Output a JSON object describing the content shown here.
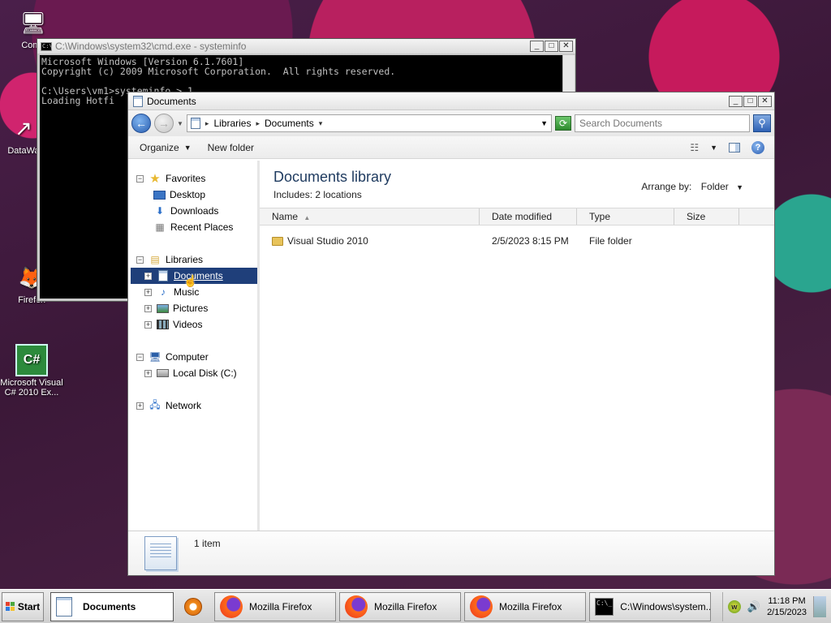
{
  "desktop": {
    "icons": [
      {
        "label": "Comp",
        "glyph": "🖥"
      },
      {
        "label": "DataWa",
        "glyph": "↗"
      },
      {
        "label": "Firefox",
        "glyph": "🦊"
      },
      {
        "label": "Microsoft Visual C# 2010 Ex...",
        "glyph": "C#"
      }
    ]
  },
  "cmd": {
    "title": "C:\\Windows\\system32\\cmd.exe - systeminfo",
    "lines": "Microsoft Windows [Version 6.1.7601]\nCopyright (c) 2009 Microsoft Corporation.  All rights reserved.\n\nC:\\Users\\vm1>systeminfo > 1\nLoading Hotfi"
  },
  "explorer": {
    "title": "Documents",
    "breadcrumb": [
      "Libraries",
      "Documents"
    ],
    "search_placeholder": "Search Documents",
    "toolbar": {
      "organize": "Organize",
      "new_folder": "New folder"
    },
    "nav": {
      "favorites": "Favorites",
      "desktop": "Desktop",
      "downloads": "Downloads",
      "recent": "Recent Places",
      "libraries": "Libraries",
      "documents": "Documents",
      "music": "Music",
      "pictures": "Pictures",
      "videos": "Videos",
      "computer": "Computer",
      "local_disk": "Local Disk (C:)",
      "network": "Network"
    },
    "library": {
      "title": "Documents library",
      "includes_label": "Includes:",
      "includes_link": "2 locations",
      "arrange_label": "Arrange by:",
      "arrange_value": "Folder"
    },
    "columns": [
      "Name",
      "Date modified",
      "Type",
      "Size"
    ],
    "files": [
      {
        "name": "Visual Studio 2010",
        "date": "2/5/2023 8:15 PM",
        "type": "File folder",
        "size": ""
      }
    ],
    "details": {
      "count": "1 item"
    }
  },
  "taskbar": {
    "start": "Start",
    "items": [
      "Documents",
      "Mozilla Firefox",
      "Mozilla Firefox",
      "Mozilla Firefox",
      "C:\\Windows\\system..."
    ],
    "time": "11:18 PM",
    "date": "2/15/2023"
  }
}
